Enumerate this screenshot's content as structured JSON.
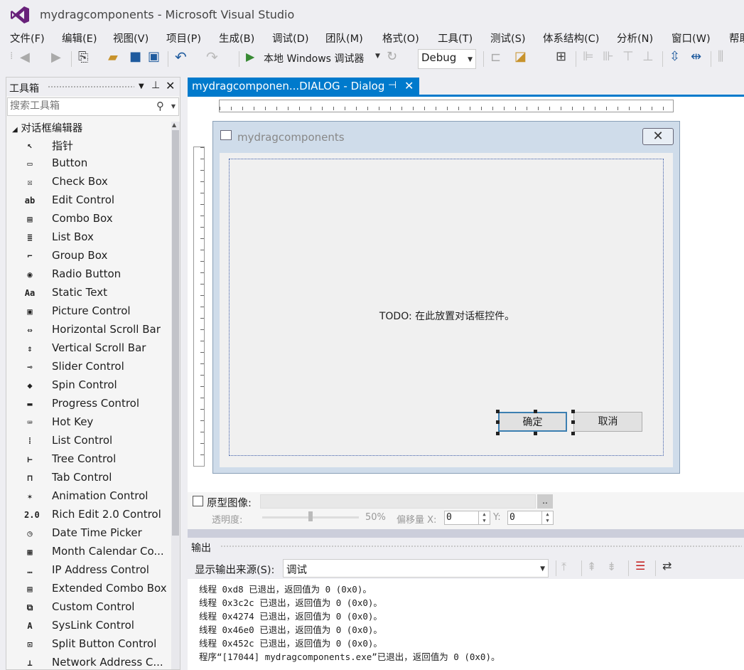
{
  "window": {
    "title": "mydragcomponents - Microsoft Visual Studio"
  },
  "menu": [
    "文件(F)",
    "编辑(E)",
    "视图(V)",
    "项目(P)",
    "生成(B)",
    "调试(D)",
    "团队(M)",
    "格式(O)",
    "工具(T)",
    "测试(S)",
    "体系结构(C)",
    "分析(N)",
    "窗口(W)",
    "帮助"
  ],
  "toolbar": {
    "run_label": "本地 Windows 调试器",
    "config": "Debug"
  },
  "toolbox": {
    "title": "工具箱",
    "search_placeholder": "搜索工具箱",
    "section": "对话框编辑器",
    "items": [
      {
        "label": "指针",
        "icon": "pointer-icon",
        "glyph": "↖"
      },
      {
        "label": "Button",
        "icon": "button-icon",
        "glyph": "▭"
      },
      {
        "label": "Check Box",
        "icon": "checkbox-icon",
        "glyph": "☒"
      },
      {
        "label": "Edit Control",
        "icon": "edit-control-icon",
        "glyph": "ab"
      },
      {
        "label": "Combo Box",
        "icon": "combo-box-icon",
        "glyph": "▤"
      },
      {
        "label": "List Box",
        "icon": "list-box-icon",
        "glyph": "≣"
      },
      {
        "label": "Group Box",
        "icon": "group-box-icon",
        "glyph": "⌐"
      },
      {
        "label": "Radio Button",
        "icon": "radio-button-icon",
        "glyph": "◉"
      },
      {
        "label": "Static Text",
        "icon": "static-text-icon",
        "glyph": "Aa"
      },
      {
        "label": "Picture Control",
        "icon": "picture-control-icon",
        "glyph": "▣"
      },
      {
        "label": "Horizontal Scroll Bar",
        "icon": "hscroll-icon",
        "glyph": "⇔"
      },
      {
        "label": "Vertical Scroll Bar",
        "icon": "vscroll-icon",
        "glyph": "⇕"
      },
      {
        "label": "Slider Control",
        "icon": "slider-icon",
        "glyph": "⊸"
      },
      {
        "label": "Spin Control",
        "icon": "spin-icon",
        "glyph": "◆"
      },
      {
        "label": "Progress Control",
        "icon": "progress-icon",
        "glyph": "▬"
      },
      {
        "label": "Hot Key",
        "icon": "hot-key-icon",
        "glyph": "⌨"
      },
      {
        "label": "List Control",
        "icon": "list-control-icon",
        "glyph": "⁞"
      },
      {
        "label": "Tree Control",
        "icon": "tree-control-icon",
        "glyph": "⊢"
      },
      {
        "label": "Tab Control",
        "icon": "tab-control-icon",
        "glyph": "⊓"
      },
      {
        "label": "Animation Control",
        "icon": "animation-icon",
        "glyph": "✶"
      },
      {
        "label": "Rich Edit 2.0 Control",
        "icon": "rich-edit-icon",
        "glyph": "2.0"
      },
      {
        "label": "Date Time Picker",
        "icon": "date-time-icon",
        "glyph": "◷"
      },
      {
        "label": "Month Calendar Co...",
        "icon": "month-calendar-icon",
        "glyph": "▦"
      },
      {
        "label": "IP Address Control",
        "icon": "ip-address-icon",
        "glyph": "…"
      },
      {
        "label": "Extended Combo Box",
        "icon": "extended-combo-icon",
        "glyph": "▤"
      },
      {
        "label": "Custom Control",
        "icon": "custom-control-icon",
        "glyph": "⧉"
      },
      {
        "label": "SysLink Control",
        "icon": "syslink-icon",
        "glyph": "A"
      },
      {
        "label": "Split Button Control",
        "icon": "split-button-icon",
        "glyph": "⊡"
      },
      {
        "label": "Network Address C...",
        "icon": "network-address-icon",
        "glyph": "⊥"
      }
    ]
  },
  "document_tab": {
    "label": "mydragcomponen...DIALOG - Dialog"
  },
  "dialog": {
    "title": "mydragcomponents",
    "todo": "TODO:  在此放置对话框控件。",
    "ok": "确定",
    "cancel": "取消"
  },
  "prototype": {
    "label": "原型图像:",
    "browse": "..",
    "transparency_label": "透明度:",
    "transparency": "50%",
    "offset_label": "偏移量 X:",
    "x": "0",
    "y_label": "Y:",
    "y": "0"
  },
  "output": {
    "title": "输出",
    "source_label": "显示输出来源(S):",
    "source": "调试",
    "lines": [
      "线程 0xd8 已退出，返回值为 0 (0x0)。",
      "线程 0x3c2c 已退出，返回值为 0 (0x0)。",
      "线程 0x4274 已退出，返回值为 0 (0x0)。",
      "线程 0x46e0 已退出，返回值为 0 (0x0)。",
      "线程 0x452c 已退出，返回值为 0 (0x0)。",
      "程序“[17044] mydragcomponents.exe”已退出，返回值为 0 (0x0)。"
    ]
  },
  "colors": {
    "accent": "#007acc",
    "vs_purple": "#68217a",
    "dialog_frame": "#cfdcea"
  }
}
